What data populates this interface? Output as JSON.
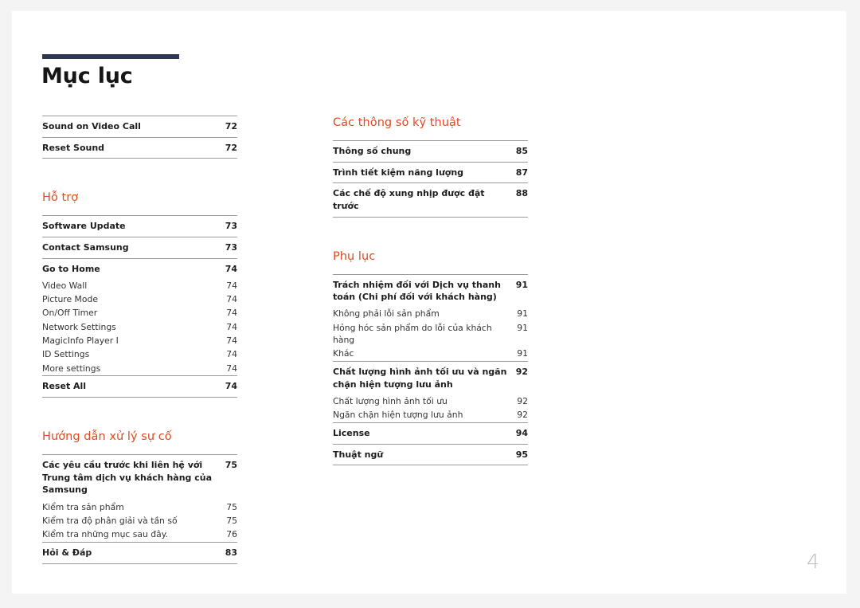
{
  "document": {
    "title": "Mục lục",
    "page_number": "4",
    "accent_color": "#df4a1e",
    "rule_color": "#2e3650"
  },
  "left_column": {
    "groups": [
      {
        "heading": null,
        "entries": [
          {
            "label": "Sound on Video Call",
            "page": "72",
            "level": 1,
            "rule": true
          },
          {
            "label": "Reset Sound",
            "page": "72",
            "level": 1,
            "rule": true
          }
        ]
      },
      {
        "heading": "Hỗ trợ",
        "entries": [
          {
            "label": "Software Update",
            "page": "73",
            "level": 1,
            "rule": true
          },
          {
            "label": "Contact Samsung",
            "page": "73",
            "level": 1,
            "rule": true
          },
          {
            "label": "Go to Home",
            "page": "74",
            "level": 1,
            "rule": true
          },
          {
            "label": "Video Wall",
            "page": "74",
            "level": 2,
            "rule": false
          },
          {
            "label": "Picture Mode",
            "page": "74",
            "level": 2,
            "rule": false
          },
          {
            "label": "On/Off Timer",
            "page": "74",
            "level": 2,
            "rule": false
          },
          {
            "label": "Network Settings",
            "page": "74",
            "level": 2,
            "rule": false
          },
          {
            "label": "MagicInfo Player I",
            "page": "74",
            "level": 2,
            "rule": false
          },
          {
            "label": "ID Settings",
            "page": "74",
            "level": 2,
            "rule": false
          },
          {
            "label": "More settings",
            "page": "74",
            "level": 2,
            "rule": false
          },
          {
            "label": "Reset All",
            "page": "74",
            "level": 1,
            "rule": true
          }
        ]
      },
      {
        "heading": "Hướng dẫn xử lý sự cố",
        "entries": [
          {
            "label": "Các yêu cầu trước khi liên hệ với Trung tâm dịch vụ khách hàng của Samsung",
            "page": "75",
            "level": 1,
            "rule": true
          },
          {
            "label": "Kiểm tra sản phẩm",
            "page": "75",
            "level": 2,
            "rule": false
          },
          {
            "label": "Kiểm tra độ phân giải và tần số",
            "page": "75",
            "level": 2,
            "rule": false
          },
          {
            "label": "Kiểm tra những mục sau đây.",
            "page": "76",
            "level": 2,
            "rule": false
          },
          {
            "label": "Hỏi & Đáp",
            "page": "83",
            "level": 1,
            "rule": true
          }
        ]
      }
    ]
  },
  "right_column": {
    "groups": [
      {
        "heading": "Các thông số kỹ thuật",
        "entries": [
          {
            "label": "Thông số chung",
            "page": "85",
            "level": 1,
            "rule": true
          },
          {
            "label": "Trình tiết kiệm năng lượng",
            "page": "87",
            "level": 1,
            "rule": true
          },
          {
            "label": "Các chế độ xung nhịp được đặt trước",
            "page": "88",
            "level": 1,
            "rule": true
          }
        ]
      },
      {
        "heading": "Phụ lục",
        "entries": [
          {
            "label": "Trách nhiệm đối với Dịch vụ thanh toán (Chi phí đối với khách hàng)",
            "page": "91",
            "level": 1,
            "rule": true
          },
          {
            "label": "Không phải lỗi sản phẩm",
            "page": "91",
            "level": 2,
            "rule": false
          },
          {
            "label": "Hỏng hóc sản phẩm do lỗi của khách hàng",
            "page": "91",
            "level": 2,
            "rule": false
          },
          {
            "label": "Khác",
            "page": "91",
            "level": 2,
            "rule": false
          },
          {
            "label": "Chất lượng hình ảnh tối ưu và ngăn chặn hiện tượng lưu ảnh",
            "page": "92",
            "level": 1,
            "rule": true
          },
          {
            "label": "Chất lượng hình ảnh tối ưu",
            "page": "92",
            "level": 2,
            "rule": false
          },
          {
            "label": "Ngăn chặn hiện tượng lưu ảnh",
            "page": "92",
            "level": 2,
            "rule": false
          },
          {
            "label": "License",
            "page": "94",
            "level": 1,
            "rule": true
          },
          {
            "label": "Thuật ngữ",
            "page": "95",
            "level": 1,
            "rule": true
          }
        ]
      }
    ]
  }
}
